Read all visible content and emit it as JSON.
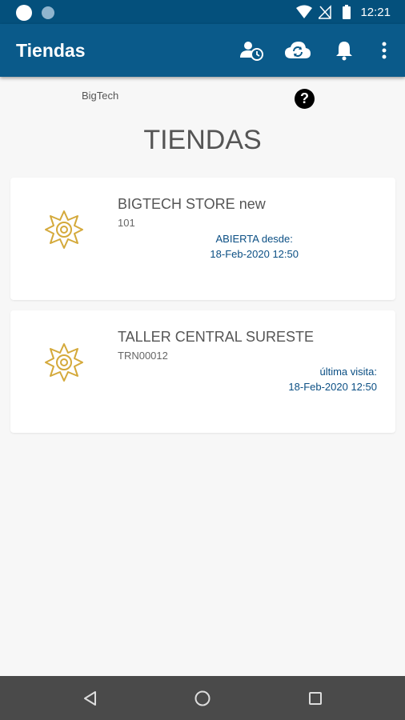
{
  "status_bar": {
    "time": "12:21"
  },
  "app_bar": {
    "title": "Tiendas",
    "actions": [
      "user-clock-icon",
      "cloud-sync-icon",
      "bell-icon",
      "more-vert-icon"
    ]
  },
  "header": {
    "company": "BigTech",
    "help_label": "?",
    "page_title": "TIENDAS"
  },
  "stores": [
    {
      "name": "BIGTECH STORE new",
      "code": "101",
      "status_label": "ABIERTA desde:",
      "status_date": "18-Feb-2020 12:50",
      "icon": "sun-icon"
    },
    {
      "name": "TALLER CENTRAL SURESTE",
      "code": "TRN00012",
      "status_label": "última visita:",
      "status_date": "18-Feb-2020 12:50",
      "icon": "sun-icon"
    }
  ],
  "colors": {
    "primary": "#0a5a8a",
    "status_bar": "#04507c",
    "accent_text": "#0b4f84",
    "icon": "#d4a93a"
  }
}
